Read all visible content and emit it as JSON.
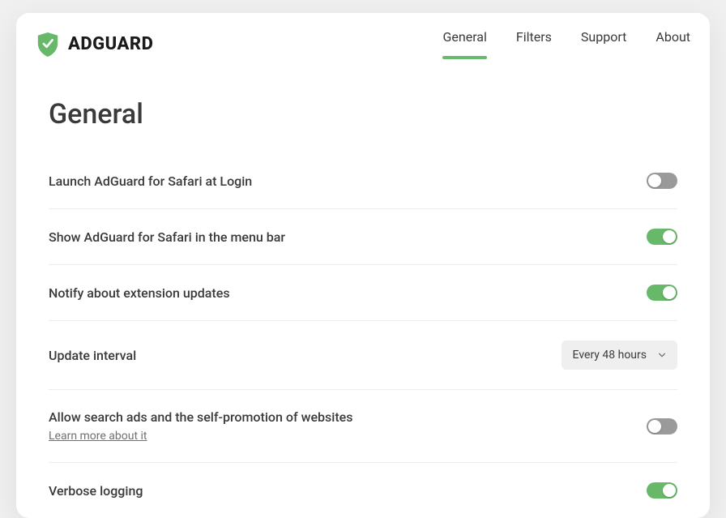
{
  "brand": {
    "name": "ADGUARD",
    "accent": "#67b868"
  },
  "nav": {
    "items": [
      {
        "key": "general",
        "label": "General",
        "active": true
      },
      {
        "key": "filters",
        "label": "Filters",
        "active": false
      },
      {
        "key": "support",
        "label": "Support",
        "active": false
      },
      {
        "key": "about",
        "label": "About",
        "active": false
      }
    ]
  },
  "page": {
    "title": "General"
  },
  "settings": {
    "launch_at_login": {
      "label": "Launch AdGuard for Safari at Login",
      "value": false
    },
    "show_menu_bar": {
      "label": "Show AdGuard for Safari in the menu bar",
      "value": true
    },
    "notify_updates": {
      "label": "Notify about extension updates",
      "value": true
    },
    "update_interval": {
      "label": "Update interval",
      "selected": "Every 48 hours"
    },
    "allow_search_ads": {
      "label": "Allow search ads and the self-promotion of websites",
      "learn_more": "Learn more about it",
      "value": false
    },
    "verbose_logging": {
      "label": "Verbose logging",
      "value": true
    }
  }
}
